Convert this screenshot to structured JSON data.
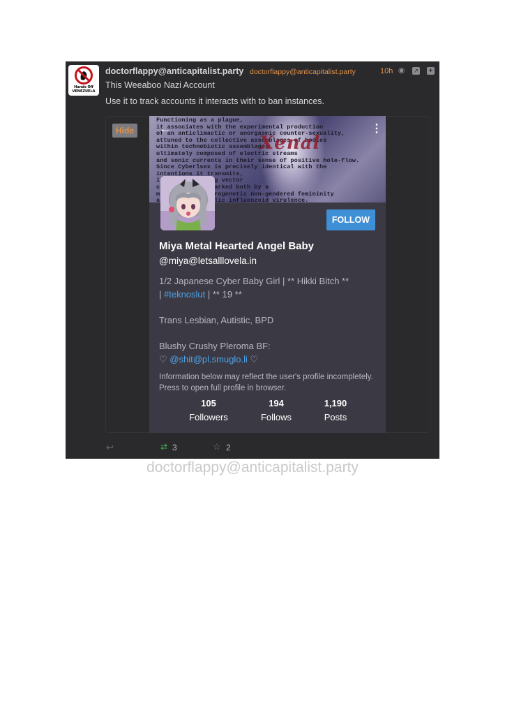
{
  "status": {
    "author_name": "doctorflappy@anticapitalist.party",
    "author_handle": "doctorflappy@anticapitalist.party",
    "time": "10h",
    "title": "This Weeaboo Nazi Account",
    "body": "Use it to track accounts it interacts with to ban instances.",
    "avatar_text_line1": "Hands Off",
    "avatar_text_line2": "VENEZUELA",
    "icons": [
      "globe-icon",
      "expand-icon",
      "plus-icon"
    ]
  },
  "attachment": {
    "hide_label": "Hide"
  },
  "profile": {
    "banner_text": "Functioning as a plague,\nit associates with the experimental production\nof an anticlimactic or anorgasmic counter-sexuality,\nattuned to the collective assemblages of bodies\nwithin technobiotic assemblages\nultimately composed of electric streams\nand sonic currents in their sense of positive hole-flow.\nSince Cyberlsex is precisely identical with the\nintentions it transmits,\nits ever-shifting vector\ncomposition is marked both by a\nmachinic or oestrogenetic non-gendered femininity\nand a haemometallic influenzoid virulence.",
    "banner_overlay": "Xenal",
    "follow_label": "FOLLOW",
    "name": "Miya Metal Hearted Angel Baby",
    "handle": "@miya@letsalllovela.in",
    "bio_line1": "1/2 Japanese Cyber Baby Girl | ** Hikki Bitch **",
    "bio_line2_prefix": "| ",
    "bio_line2_link": "#teknoslut",
    "bio_line2_suffix": " | ** 19 **",
    "bio_line3": "Trans Lesbian, Autistic, BPD",
    "bio_line4": "Blushy Crushy Pleroma BF:",
    "bio_line5_prefix": "♡ ",
    "bio_line5_link": "@shit@pl.smuglo.li",
    "bio_line5_suffix": " ♡",
    "note": "Information below may reflect the user's profile incompletely. Press to open full profile in browser.",
    "stats": {
      "followers_value": "105",
      "followers_label": "Followers",
      "follows_value": "194",
      "follows_label": "Follows",
      "posts_value": "1,190",
      "posts_label": "Posts"
    }
  },
  "actions": {
    "repeat_count": "3",
    "favorite_count": "2"
  },
  "caption": "doctorflappy@anticapitalist.party",
  "colors": {
    "card_bg": "#2a2a2d",
    "accent_orange": "#e2924a",
    "link_blue": "#4ea2e8",
    "follow_blue": "#3f8fd6",
    "repeat_green": "#3cb54a"
  }
}
